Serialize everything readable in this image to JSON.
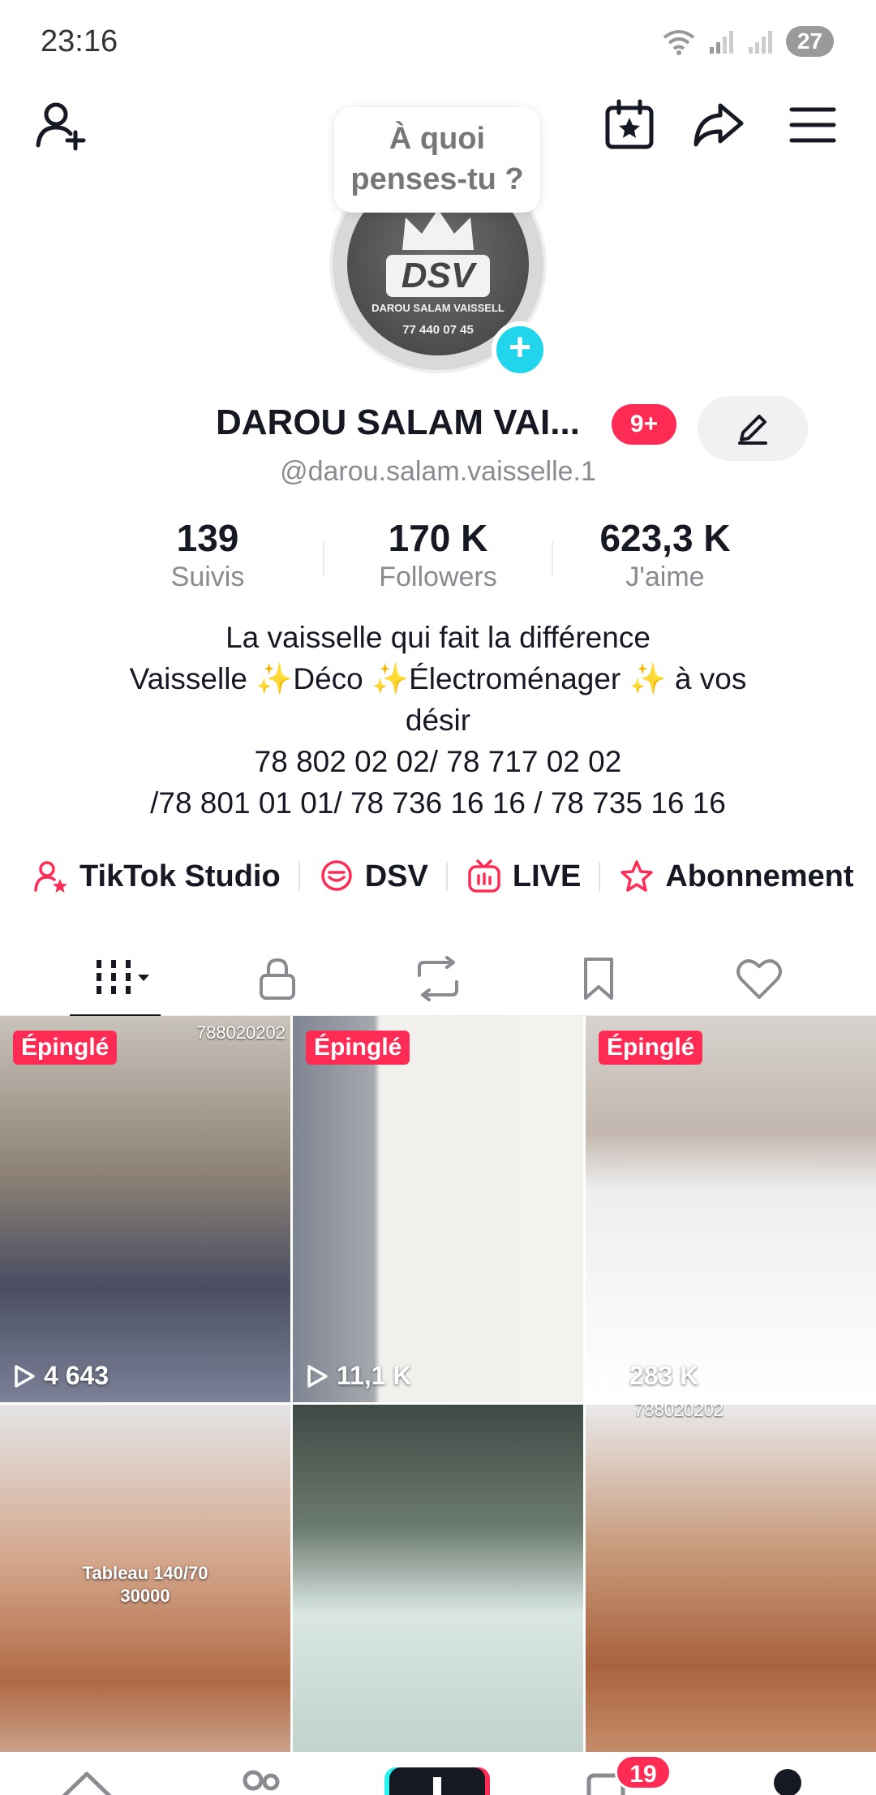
{
  "status_bar": {
    "time": "23:16",
    "battery": "27"
  },
  "thought_bubble": {
    "line1": "À quoi",
    "line2": "penses-tu ?"
  },
  "avatar": {
    "logo_text": "DSV",
    "subtitle": "DAROU SALAM VAISSELL",
    "phone": "77 440 07 45"
  },
  "profile": {
    "name": "DAROU SALAM VAI...",
    "notifications": "9+",
    "username": "@darou.salam.vaisselle.1"
  },
  "stats": [
    {
      "value": "139",
      "label": "Suivis"
    },
    {
      "value": "170 K",
      "label": "Followers"
    },
    {
      "value": "623,3 K",
      "label": "J'aime"
    }
  ],
  "bio": {
    "line1": "La vaisselle qui fait la différence",
    "line2": "Vaisselle ✨Déco ✨Électroménager ✨ à vos",
    "line3": "désir",
    "line4": "78 802 02 02/ 78 717 02 02",
    "line5": "/78 801 01 01/ 78 736 16 16 / 78 735 16 16"
  },
  "links": [
    {
      "label": "TikTok Studio",
      "icon": "user-star-icon"
    },
    {
      "label": "DSV",
      "icon": "chat-bubble-icon"
    },
    {
      "label": "LIVE",
      "icon": "live-tv-icon"
    },
    {
      "label": "Abonnement",
      "icon": "star-badge-icon"
    }
  ],
  "tabs": [
    "videos-grid-icon",
    "lock-icon",
    "repost-icon",
    "bookmark-icon",
    "heart-icon"
  ],
  "videos": [
    {
      "pinned": "Épinglé",
      "views": "4 643",
      "overlay": "788020202"
    },
    {
      "pinned": "Épinglé",
      "views": "11,1 K"
    },
    {
      "pinned": "Épinglé",
      "views": "283 K"
    },
    {
      "caption_line1": "Tableau 140/70",
      "caption_line2": "30000"
    },
    {},
    {
      "overlay": "788020202"
    }
  ],
  "bottom_nav": {
    "inbox_badge": "19"
  },
  "colors": {
    "accent": "#fe2c55",
    "cyan": "#20d5ec",
    "text": "#161823",
    "muted": "#8a8b91"
  }
}
